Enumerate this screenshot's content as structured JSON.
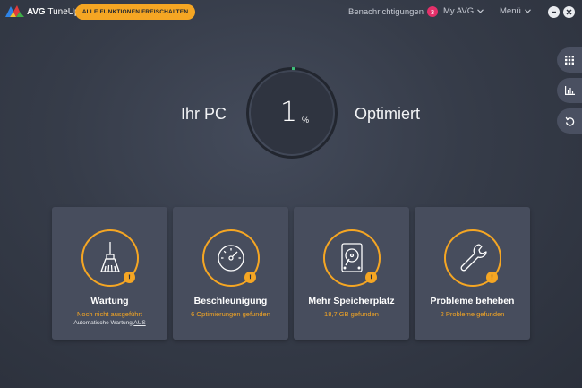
{
  "app": {
    "logo_text": "AVG",
    "product_name": "TuneUp",
    "unlock_label": "ALLE FUNKTIONEN FREISCHALTEN"
  },
  "nav": {
    "notifications_label": "Benachrichtigungen",
    "notifications_count": "3",
    "myavg_label": "My AVG",
    "menu_label": "Menü"
  },
  "window_controls": {
    "minimize": "–",
    "close": "✕"
  },
  "status": {
    "left_label": "Ihr PC",
    "value": "1",
    "unit": "%",
    "right_label": "Optimiert",
    "progress_percent": 1
  },
  "cards": [
    {
      "title": "Wartung",
      "status": "Noch nicht ausgeführt",
      "sub_prefix": "Automatische Wartung",
      "sub_link": "AUS",
      "icon": "broom-icon"
    },
    {
      "title": "Beschleunigung",
      "status": "6 Optimierungen gefunden",
      "icon": "speedometer-icon"
    },
    {
      "title": "Mehr Speicherplatz",
      "status": "18,7 GB gefunden",
      "icon": "hard-drive-icon"
    },
    {
      "title": "Probleme beheben",
      "status": "2 Probleme gefunden",
      "icon": "wrench-icon"
    }
  ],
  "warning_glyph": "!",
  "colors": {
    "accent": "#f5a623",
    "badge": "#e5306a",
    "card": "#474d5d",
    "background": "#363c49",
    "gauge_progress": "#3fc07a"
  }
}
